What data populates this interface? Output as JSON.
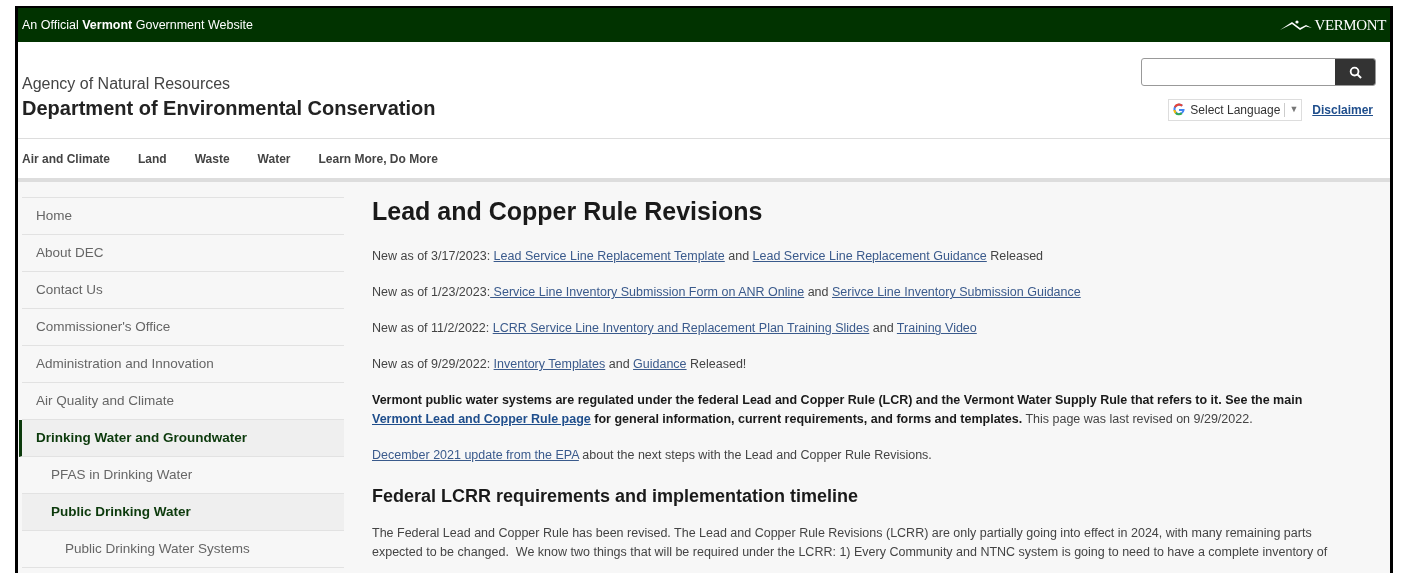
{
  "gov_bar": {
    "notice": "An Official **Vermont** Government Website",
    "logo_text": "VERMONT"
  },
  "header": {
    "agency": "Agency of Natural Resources",
    "department": "Department of Environmental Conservation",
    "language_select": {
      "label": "Select Language",
      "arrow": "▼"
    },
    "disclaimer": "Disclaimer"
  },
  "nav": [
    "Air and Climate",
    "Land",
    "Waste",
    "Water",
    "Learn More, Do More"
  ],
  "sidebar": {
    "items": [
      {
        "label": "Home",
        "selected": false
      },
      {
        "label": "About DEC",
        "selected": false
      },
      {
        "label": "Contact Us",
        "selected": false
      },
      {
        "label": "Commissioner's Office",
        "selected": false
      },
      {
        "label": "Administration and Innovation",
        "selected": false
      },
      {
        "label": "Air Quality and Climate",
        "selected": false
      },
      {
        "label": "Drinking Water and Groundwater",
        "selected": true,
        "children": [
          {
            "label": "PFAS in Drinking Water",
            "selected": false
          },
          {
            "label": "Public Drinking Water",
            "selected": true,
            "children": [
              {
                "label": "Public Drinking Water Systems",
                "selected": false
              }
            ]
          }
        ]
      }
    ]
  },
  "main": {
    "title": "Lead and Copper Rule Revisions",
    "updates": [
      [
        {
          "kind": "text",
          "text": "New as of 3/17/2023: "
        },
        {
          "kind": "link",
          "text": "Lead Service Line Replacement Template"
        },
        {
          "kind": "text",
          "text": " and "
        },
        {
          "kind": "link",
          "text": "Lead Service Line Replacement Guidance"
        },
        {
          "kind": "text",
          "text": " Released"
        }
      ],
      [
        {
          "kind": "text",
          "text": "New as of 1/23/2023:"
        },
        {
          "kind": "link",
          "text": " Service Line Inventory Submission Form on ANR Online"
        },
        {
          "kind": "text",
          "text": " and "
        },
        {
          "kind": "link",
          "text": "Serivce Line Inventory Submission Guidance"
        }
      ],
      [
        {
          "kind": "text",
          "text": "New as of 11/2/2022: "
        },
        {
          "kind": "link",
          "text": "LCRR Service Line Inventory and Replacement Plan Training Slides"
        },
        {
          "kind": "text",
          "text": " and "
        },
        {
          "kind": "link",
          "text": "Training Video"
        }
      ],
      [
        {
          "kind": "text",
          "text": "New as of 9/29/2022: "
        },
        {
          "kind": "link",
          "text": "Inventory Templates"
        },
        {
          "kind": "text",
          "text": " and "
        },
        {
          "kind": "link",
          "text": "Guidance"
        },
        {
          "kind": "text",
          "text": " Released!"
        }
      ],
      [
        {
          "kind": "bold",
          "text": "Vermont public water systems are regulated under the federal Lead and Copper Rule (LCR) and the Vermont Water Supply Rule that refers to it. See the main "
        },
        {
          "kind": "boldlink",
          "text": "Vermont Lead and Copper Rule page"
        },
        {
          "kind": "bold",
          "text": " for general information, current requirements, and forms and templates."
        },
        {
          "kind": "text",
          "text": " This page was last revised on 9/29/2022."
        }
      ],
      [
        {
          "kind": "link",
          "text": "December 2021 update from the EPA"
        },
        {
          "kind": "text",
          "text": " about the next steps with the Lead and Copper Rule Revisions."
        }
      ]
    ],
    "subheading": "Federal LCRR requirements and implementation timeline",
    "paragraph": "The Federal Lead and Copper Rule has been revised. The Lead and Copper Rule Revisions (LCRR) are only partially going into effect in 2024, with many remaining parts expected to be changed.  We know two things that will be required under the LCRR: 1) Every Community and NTNC system is going to need to have a complete inventory of"
  }
}
